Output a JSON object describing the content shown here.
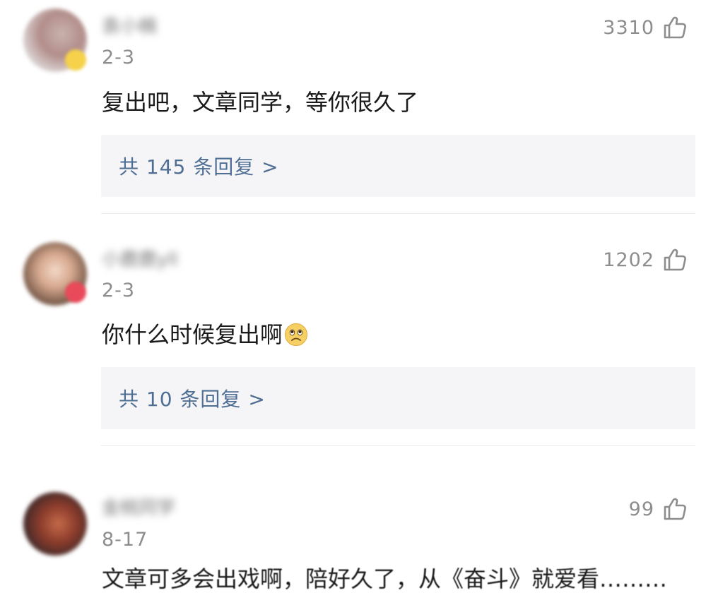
{
  "comments": [
    {
      "username": "袁小楠",
      "date": "2-3",
      "likes": "3310",
      "text": "复出吧，文章同学，等你很久了",
      "replies": "共 145 条回复 >",
      "avatar_color": "#c9b3ae",
      "badge_color": "#f5d24a"
    },
    {
      "username": "小鹿鹿yll",
      "date": "2-3",
      "likes": "1202",
      "text": "你什么时候复出啊",
      "emoji": "worried-face-emoji",
      "replies": "共 10 条回复 >",
      "avatar_color": "#d6a98f",
      "badge_color": "#e84a5a"
    },
    {
      "username": "金桃同学",
      "date": "8-17",
      "likes": "99",
      "text": "文章可多会出戏啊，陪好久了，从《奋斗》就爱看………",
      "avatar_color": "#8a3b2b"
    }
  ],
  "colors": {
    "reply_link": "#4f6e94",
    "meta_gray": "#8d8d8d",
    "reply_background": "#f5f5f7",
    "divider": "#ebebeb"
  },
  "icons": {
    "like": "thumbs-up-outline-icon"
  }
}
